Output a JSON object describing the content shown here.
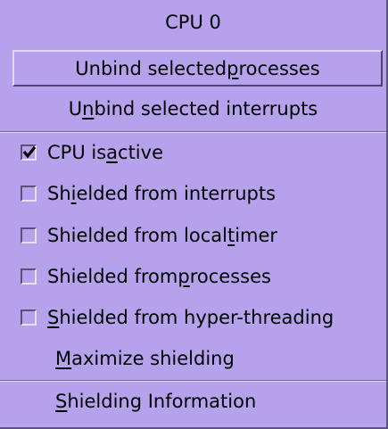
{
  "menu": {
    "title": "CPU 0",
    "unbind_processes": {
      "pre": "Unbind selected ",
      "u": "p",
      "post": "rocesses"
    },
    "unbind_interrupts": {
      "pre": "U",
      "u": "n",
      "post": "bind selected interrupts"
    },
    "cpu_active": {
      "pre": "CPU is ",
      "u": "a",
      "post": "ctive",
      "checked": true
    },
    "shield_interrupts": {
      "pre": "Sh",
      "u": "i",
      "post": "elded from interrupts",
      "checked": false
    },
    "shield_timer": {
      "pre": "Shielded from local ",
      "u": "t",
      "post": "imer",
      "checked": false
    },
    "shield_processes": {
      "pre": "Shielded from ",
      "u": "p",
      "post": "rocesses",
      "checked": false
    },
    "shield_hyperthreading": {
      "pre": "",
      "u": "S",
      "post": "hielded from hyper-threading",
      "checked": false
    },
    "maximize": {
      "pre": "",
      "u": "M",
      "post": "aximize shielding"
    },
    "info": {
      "pre": "",
      "u": "S",
      "post": "hielding Information"
    }
  },
  "colors": {
    "menu_bg": "#b6a2ec",
    "shadow": "#5e5480",
    "highlight": "#e2d8ff"
  },
  "icons": {
    "checked": "checkmark-icon",
    "unchecked": "empty-checkbox-icon"
  }
}
